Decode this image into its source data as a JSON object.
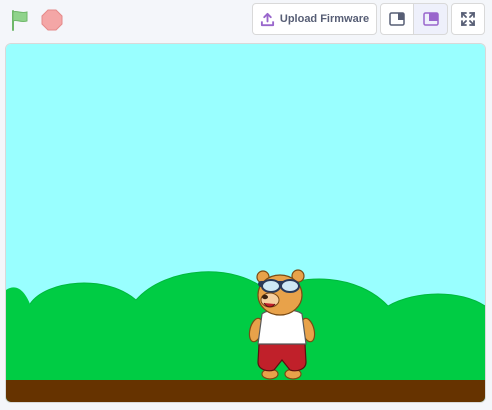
{
  "toolbar": {
    "green_flag_icon": "green-flag-icon",
    "stop_icon": "stop-sign-icon",
    "upload_label": "Upload Firmware",
    "upload_icon": "upload-icon",
    "small_stage_icon": "small-stage-icon",
    "large_stage_icon": "large-stage-icon",
    "fullscreen_icon": "fullscreen-icon"
  },
  "stage": {
    "sprite": "bear-with-goggles",
    "backdrop": "hills-and-sky"
  },
  "colors": {
    "sky": "#99ffff",
    "grass": "#00cc44",
    "ground": "#663300",
    "accent": "#9966cc",
    "flag": "#8fd38b",
    "stop": "#f4a6a6"
  }
}
